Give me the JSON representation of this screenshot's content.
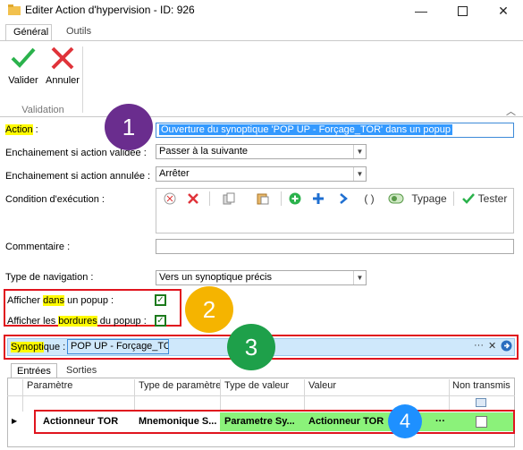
{
  "window": {
    "title": "Editer Action d'hypervision - ID: 926",
    "controls": [
      "minimize",
      "maximize",
      "close"
    ]
  },
  "ribbon": {
    "tabs": [
      {
        "label": "Général",
        "active": true
      },
      {
        "label": "Outils",
        "active": false
      }
    ],
    "buttons": [
      {
        "label": "Valider",
        "icon": "check-icon"
      },
      {
        "label": "Annuler",
        "icon": "cross-icon"
      }
    ],
    "group_label": "Validation"
  },
  "form": {
    "action": {
      "label": "Action",
      "colon": ":",
      "value": "Ouverture du synoptique 'POP UP - Forçage_TOR' dans un popup"
    },
    "on_validated": {
      "label": "Enchainement si action validée :",
      "value": "Passer à la suivante"
    },
    "on_cancelled": {
      "label": "Enchainement si action annulée :",
      "value": "Arrêter"
    },
    "condition": {
      "label": "Condition d'exécution :",
      "typage": "Typage",
      "tester": "Tester",
      "parens": "( )"
    },
    "comment": {
      "label": "Commentaire :",
      "value": ""
    },
    "navigation": {
      "label": "Type de navigation :",
      "value": "Vers un synoptique précis"
    },
    "popup": {
      "prefix": "Afficher ",
      "hl": "dans",
      "suffix": " un popup :",
      "checked": true
    },
    "borders": {
      "prefix": "Afficher les ",
      "hl": "bordures",
      "suffix": " du popup :",
      "checked": true
    },
    "synoptique": {
      "label_hl": "Synopti",
      "label_rest": "que",
      "colon": " :",
      "value": "POP UP - Forçage_TOR",
      "ellipsis": "···",
      "clear": "✕"
    }
  },
  "grid": {
    "tabs": [
      "Entrées",
      "Sorties"
    ],
    "columns": [
      "Paramètre",
      "Type de paramètre",
      "Type de valeur",
      "Valeur",
      "Non transmis"
    ],
    "rows": [
      {
        "parametre": "Actionneur TOR",
        "type_param": "Mnemonique S...",
        "type_valeur": "Parametre Sy...",
        "valeur": "Actionneur TOR",
        "more": "···",
        "non_transmis": false
      }
    ]
  },
  "badges": [
    "1",
    "2",
    "3",
    "4"
  ],
  "colors": {
    "highlight": "#fffb00",
    "selection": "#3399ff",
    "annotation_red": "#e0141e",
    "badge1": "#6a2d8e",
    "badge2": "#f5b400",
    "badge3": "#1ea04a",
    "badge4": "#1e90ff",
    "row_green": "#8bf27a"
  }
}
